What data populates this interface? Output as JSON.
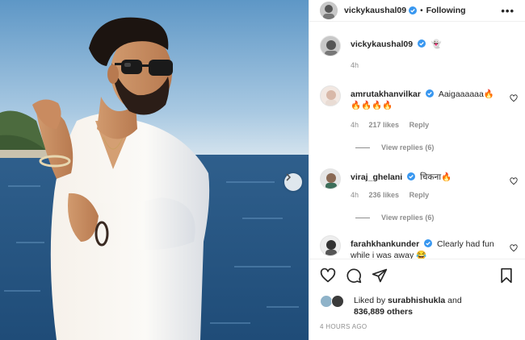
{
  "post": {
    "author": "vickykaushal09",
    "follow_separator": "•",
    "follow_label": "Following",
    "more_label": "•••"
  },
  "caption": {
    "username": "vickykaushal09",
    "emoji": "👻",
    "time": "4h"
  },
  "comments": [
    {
      "username": "amrutakhanvilkar",
      "verified": true,
      "text_line1": "Aaigaaaaaa🔥",
      "text_line2": "🔥🔥🔥🔥",
      "time": "4h",
      "likes": "217 likes",
      "reply": "Reply",
      "view_replies": "View replies (6)"
    },
    {
      "username": "viraj_ghelani",
      "verified": true,
      "text_line1": "चिकना🔥",
      "time": "4h",
      "likes": "236 likes",
      "reply": "Reply",
      "view_replies": "View replies (6)"
    },
    {
      "username": "farahkhankunder",
      "verified": true,
      "text_line1": "Clearly had fun",
      "text_line2": "while i was away 😂"
    }
  ],
  "likes": {
    "prefix": "Liked by",
    "user": "surabhishukla",
    "connector": "and",
    "count": "836,889 others"
  },
  "timestamp": "4 HOURS AGO",
  "icons": {
    "verified_color": "#3897f0",
    "next": "chevron-right-icon",
    "like": "heart-icon",
    "comment": "comment-icon",
    "share": "paper-plane-icon",
    "save": "bookmark-icon"
  }
}
